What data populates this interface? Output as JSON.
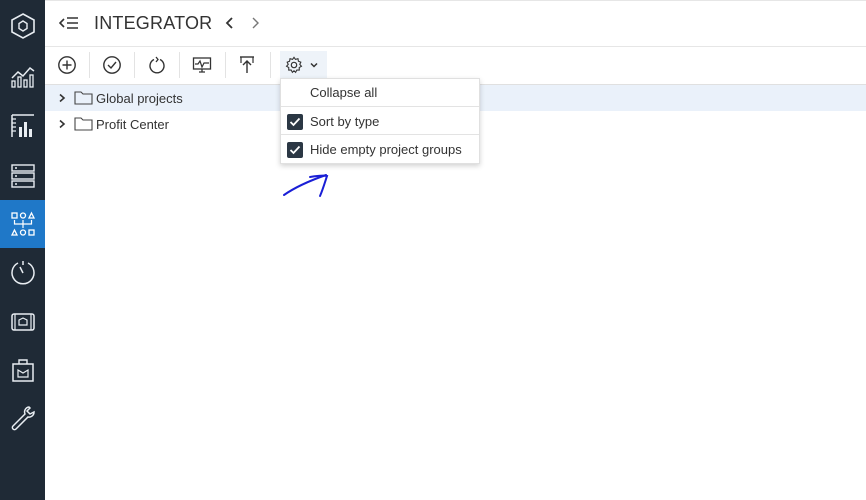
{
  "app": {
    "title": "INTEGRATOR"
  },
  "sidebar": {
    "items": [
      {
        "icon": "hexagon-logo-icon",
        "active": false
      },
      {
        "icon": "analytics-chart-icon",
        "active": false
      },
      {
        "icon": "bar-chart-icon",
        "active": false
      },
      {
        "icon": "server-rack-icon",
        "active": false
      },
      {
        "icon": "integrator-flow-icon",
        "active": true
      },
      {
        "icon": "gauge-icon",
        "active": false
      },
      {
        "icon": "film-icon",
        "active": false
      },
      {
        "icon": "package-icon",
        "active": false
      },
      {
        "icon": "wrench-icon",
        "active": false
      }
    ],
    "active_color": "#1f78c8",
    "background": "#1f2a36"
  },
  "toolbar": {
    "buttons": [
      {
        "icon": "add-circle-icon"
      },
      {
        "icon": "check-circle-icon"
      },
      {
        "icon": "refresh-icon"
      },
      {
        "icon": "monitor-icon"
      },
      {
        "icon": "upload-icon"
      },
      {
        "icon": "gear-icon"
      }
    ]
  },
  "tree": {
    "items": [
      {
        "label": "Global projects",
        "selected": true
      },
      {
        "label": "Profit Center",
        "selected": false
      }
    ]
  },
  "settings_menu": {
    "items": [
      {
        "label": "Collapse all",
        "checkbox": false
      },
      {
        "label": "Sort by type",
        "checkbox": true,
        "checked": true
      },
      {
        "label": "Hide empty project groups",
        "checkbox": true,
        "checked": true
      }
    ]
  },
  "colors": {
    "annotation": "#1a1fd6",
    "selected_row": "#eaf1fa"
  }
}
